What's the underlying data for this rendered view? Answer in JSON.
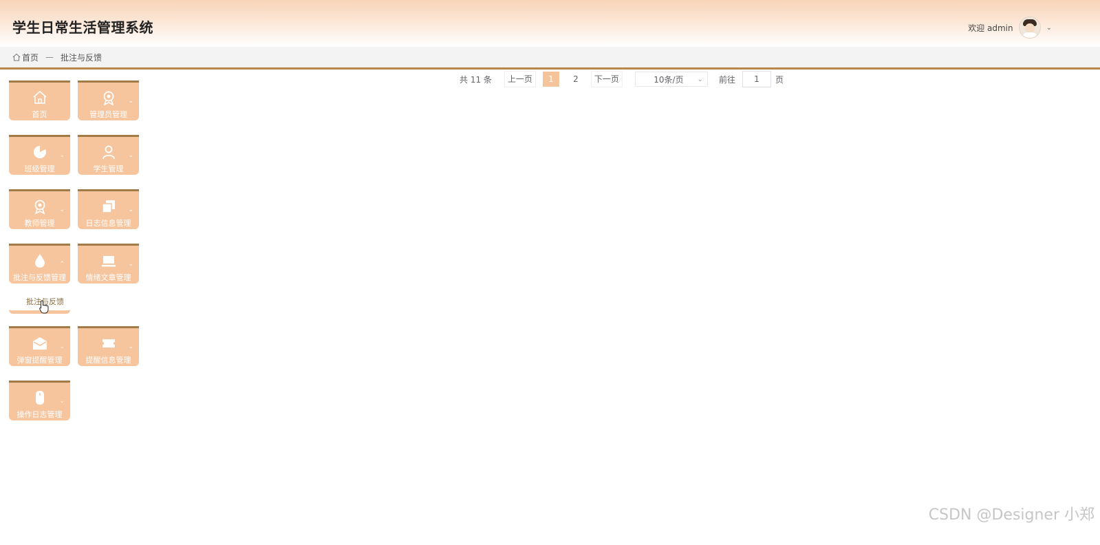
{
  "header": {
    "title": "学生日常生活管理系统",
    "welcome": "欢迎 admin"
  },
  "breadcrumb": {
    "home": "首页",
    "separator": "—",
    "current": "批注与反馈"
  },
  "pagination": {
    "total": "共 11 条",
    "prev": "上一页",
    "pages": [
      "1",
      "2"
    ],
    "current_page": "1",
    "next": "下一页",
    "page_size": "10条/页",
    "goto_label": "前往",
    "goto_value": "1",
    "goto_unit": "页"
  },
  "menu": {
    "items": [
      {
        "label": "首页",
        "icon": "home-icon"
      },
      {
        "label": "管理员管理",
        "icon": "badge-icon"
      },
      {
        "label": "班级管理",
        "icon": "pie-icon"
      },
      {
        "label": "学生管理",
        "icon": "user-icon"
      },
      {
        "label": "教师管理",
        "icon": "badge-icon"
      },
      {
        "label": "日志信息管理",
        "icon": "copy-icon"
      },
      {
        "label": "批注与反馈管理",
        "icon": "drop-icon"
      },
      {
        "label": "情绪文章管理",
        "icon": "laptop-icon"
      },
      {
        "label": "弹窗提醒管理",
        "icon": "mail-icon"
      },
      {
        "label": "提醒信息管理",
        "icon": "ticket-icon"
      },
      {
        "label": "操作日志管理",
        "icon": "mouse-icon"
      }
    ],
    "submenu_item": "批注与反馈"
  },
  "watermark": "CSDN @Designer 小郑",
  "colors": {
    "accent": "#f6c59e",
    "border": "#a27a46",
    "active_page": "#f6c49b"
  }
}
